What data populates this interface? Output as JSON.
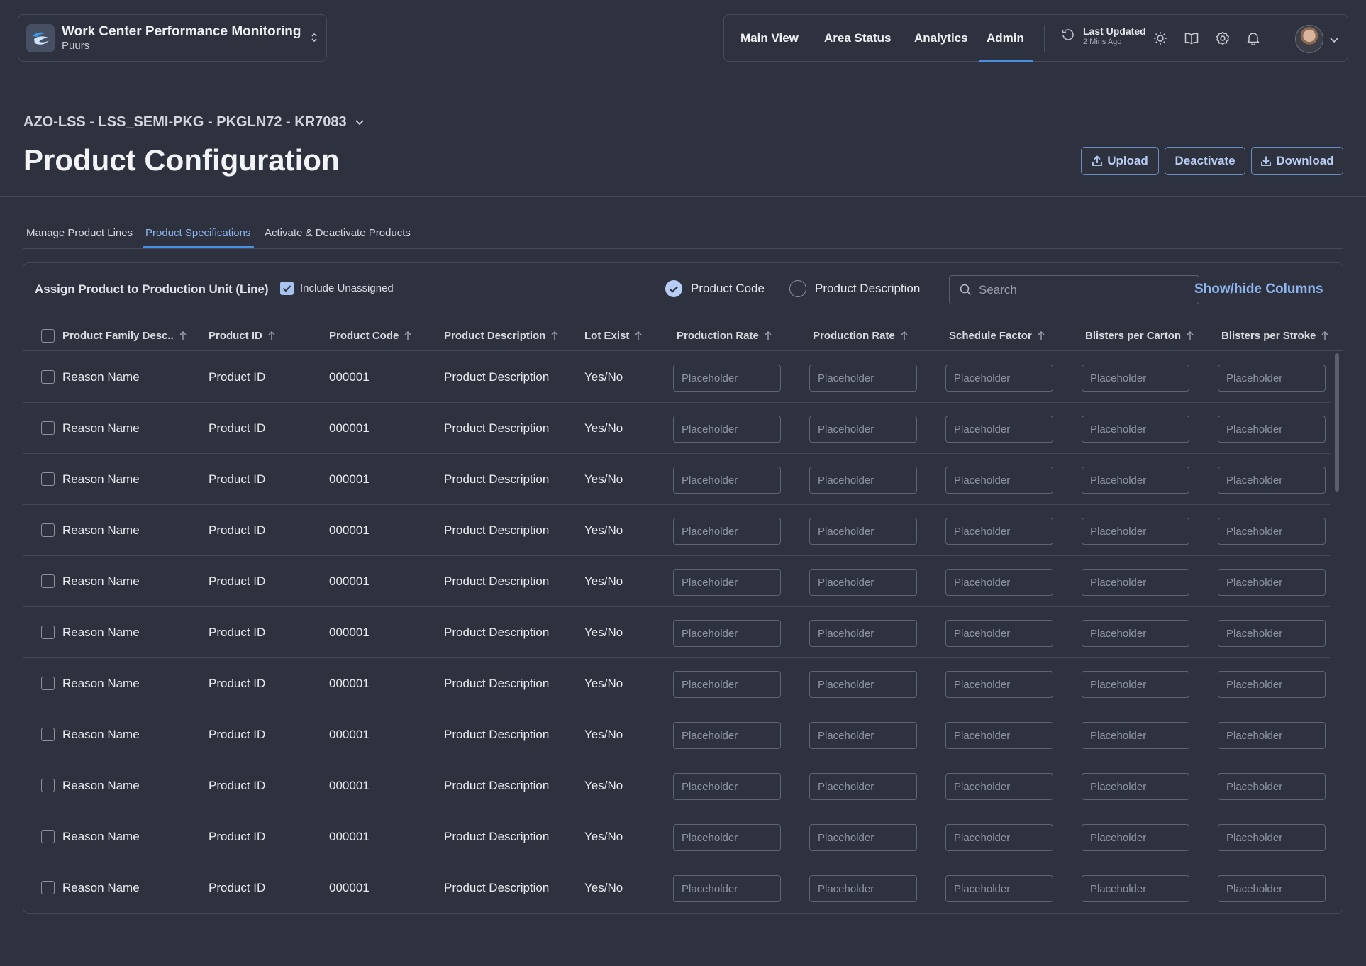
{
  "app": {
    "title": "Work Center Performance Monitoring",
    "site": "Puurs"
  },
  "nav": {
    "items": [
      {
        "label": "Main View"
      },
      {
        "label": "Area Status"
      },
      {
        "label": "Analytics"
      },
      {
        "label": "Admin",
        "active": true
      }
    ],
    "last_updated_label": "Last Updated",
    "last_updated_value": "2 Mins Ago"
  },
  "page": {
    "breadcrumb": "AZO-LSS - LSS_SEMI-PKG - PKGLN72 - KR7083",
    "title": "Product Configuration",
    "actions": {
      "upload": "Upload",
      "deactivate": "Deactivate",
      "download": "Download"
    }
  },
  "tabs": [
    {
      "label": "Manage Product Lines"
    },
    {
      "label": "Product Specifications",
      "active": true
    },
    {
      "label": "Activate & Deactivate Products"
    }
  ],
  "panel": {
    "title": "Assign Product to Production Unit (Line)",
    "include_unassigned": {
      "label": "Include Unassigned",
      "checked": true
    },
    "search_mode": {
      "product_code": "Product Code",
      "product_description": "Product Description",
      "selected": "product_code"
    },
    "search_placeholder": "Search",
    "show_hide_columns": "Show/hide Columns"
  },
  "table": {
    "columns": [
      "Product Family Desc..",
      "Product ID",
      "Product Code",
      "Product Description",
      "Lot Exist",
      "Production Rate",
      "Production Rate",
      "Schedule Factor",
      "Blisters per Carton",
      "Blisters per Stroke"
    ],
    "input_placeholder": "Placeholder",
    "rows": [
      {
        "family": "Reason Name",
        "id": "Product ID",
        "code": "000001",
        "desc": "Product Description",
        "lot": "Yes/No"
      },
      {
        "family": "Reason Name",
        "id": "Product ID",
        "code": "000001",
        "desc": "Product Description",
        "lot": "Yes/No"
      },
      {
        "family": "Reason Name",
        "id": "Product ID",
        "code": "000001",
        "desc": "Product Description",
        "lot": "Yes/No"
      },
      {
        "family": "Reason Name",
        "id": "Product ID",
        "code": "000001",
        "desc": "Product Description",
        "lot": "Yes/No"
      },
      {
        "family": "Reason Name",
        "id": "Product ID",
        "code": "000001",
        "desc": "Product Description",
        "lot": "Yes/No"
      },
      {
        "family": "Reason Name",
        "id": "Product ID",
        "code": "000001",
        "desc": "Product Description",
        "lot": "Yes/No"
      },
      {
        "family": "Reason Name",
        "id": "Product ID",
        "code": "000001",
        "desc": "Product Description",
        "lot": "Yes/No"
      },
      {
        "family": "Reason Name",
        "id": "Product ID",
        "code": "000001",
        "desc": "Product Description",
        "lot": "Yes/No"
      },
      {
        "family": "Reason Name",
        "id": "Product ID",
        "code": "000001",
        "desc": "Product Description",
        "lot": "Yes/No"
      },
      {
        "family": "Reason Name",
        "id": "Product ID",
        "code": "000001",
        "desc": "Product Description",
        "lot": "Yes/No"
      },
      {
        "family": "Reason Name",
        "id": "Product ID",
        "code": "000001",
        "desc": "Product Description",
        "lot": "Yes/No"
      }
    ]
  },
  "icons": {
    "logo": "app-logo-icon",
    "switcher": "chevron-up-down-icon",
    "history": "history-icon",
    "theme": "sun-icon",
    "docs": "book-icon",
    "settings": "gear-icon",
    "notifications": "bell-icon",
    "sort": "arrow-up-icon"
  },
  "colors": {
    "background": "#2e323f",
    "accent": "#4a90e2",
    "link": "#8fb4f0"
  }
}
